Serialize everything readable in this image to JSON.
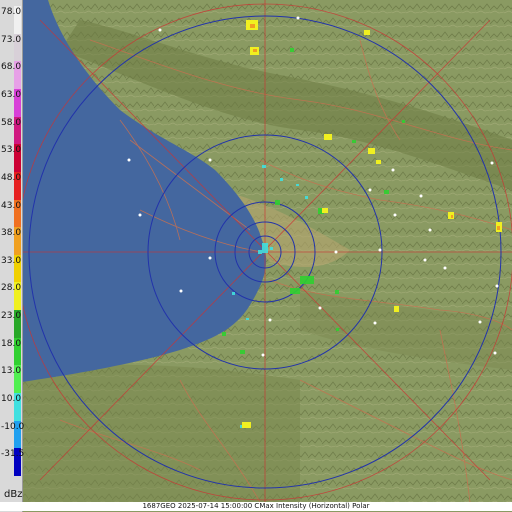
{
  "caption": "1687GEO 2025-07-14 15:00:00 CMax Intensity (Horizontal) Polar",
  "legend": {
    "unit": "dBz",
    "labels": [
      "78.0",
      "73.0",
      "68.0",
      "63.0",
      "58.0",
      "53.0",
      "48.0",
      "43.0",
      "38.0",
      "33.0",
      "28.0",
      "23.0",
      "18.0",
      "13.0",
      "10.0",
      "-10.0",
      "-31.5"
    ],
    "colors": [
      "#f0f0f0",
      "#d8d0d8",
      "#e7a0e7",
      "#d840d8",
      "#d01880",
      "#cc0033",
      "#e62020",
      "#f07020",
      "#f0a020",
      "#f0d000",
      "#f0f020",
      "#28a828",
      "#30d030",
      "#50f050",
      "#40e0e0",
      "#20a0f0",
      "#0000c0"
    ]
  },
  "map_colors": {
    "sea": "#44679f",
    "land": "#8a9a62",
    "range_rings": "#2233aa",
    "crosshair": "#cc3333",
    "borders": "#c87050"
  }
}
